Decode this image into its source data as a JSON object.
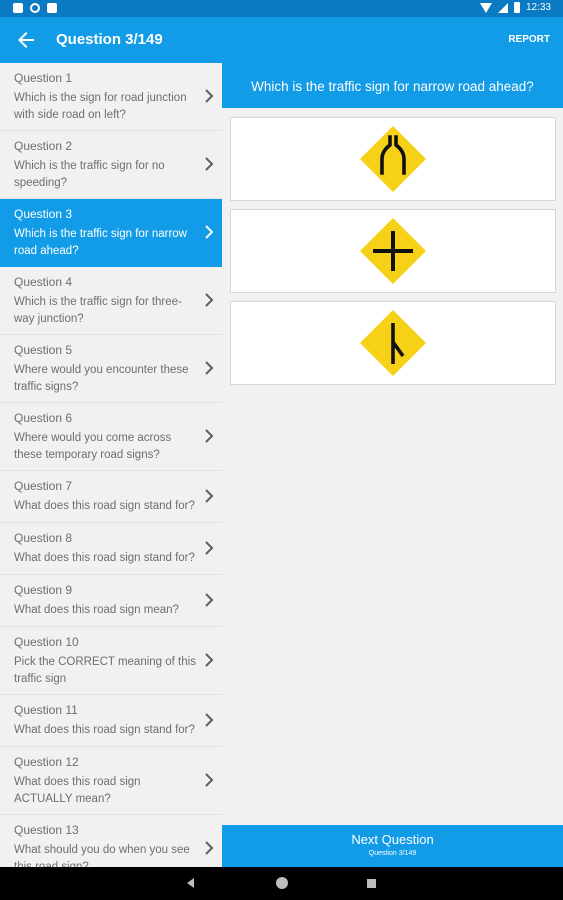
{
  "status_bar": {
    "time": "12:33"
  },
  "app_bar": {
    "title": "Question 3/149",
    "report_label": "REPORT"
  },
  "questions": [
    {
      "number": "Question 1",
      "text": "Which is the sign for road junction with side road on left?"
    },
    {
      "number": "Question 2",
      "text": "Which is the traffic sign for no speeding?"
    },
    {
      "number": "Question 3",
      "text": "Which is the traffic sign for narrow road ahead?",
      "active": true
    },
    {
      "number": "Question 4",
      "text": "Which is the traffic sign for three-way junction?"
    },
    {
      "number": "Question 5",
      "text": "Where would you encounter these traffic signs?"
    },
    {
      "number": "Question 6",
      "text": "Where would you come across these temporary road signs?"
    },
    {
      "number": "Question 7",
      "text": "What does this road sign stand for?"
    },
    {
      "number": "Question 8",
      "text": "What does this road sign stand for?"
    },
    {
      "number": "Question 9",
      "text": "What does this road sign mean?"
    },
    {
      "number": "Question 10",
      "text": "Pick the CORRECT meaning of this traffic sign"
    },
    {
      "number": "Question 11",
      "text": "What does this road sign stand for?"
    },
    {
      "number": "Question 12",
      "text": "What does this road sign ACTUALLY mean?"
    },
    {
      "number": "Question 13",
      "text": "What should you do when you see this road sign?"
    }
  ],
  "main": {
    "question": "Which is the traffic sign for narrow road ahead?",
    "options": [
      {
        "icon": "narrow-road-sign-icon"
      },
      {
        "icon": "crossroads-sign-icon"
      },
      {
        "icon": "side-road-left-sign-icon"
      }
    ]
  },
  "next_button": {
    "label": "Next Question",
    "sublabel": "Question 3/149"
  },
  "colors": {
    "primary": "#129be7",
    "status_bar": "#0a7ac2",
    "sign_yellow": "#f7d117"
  }
}
